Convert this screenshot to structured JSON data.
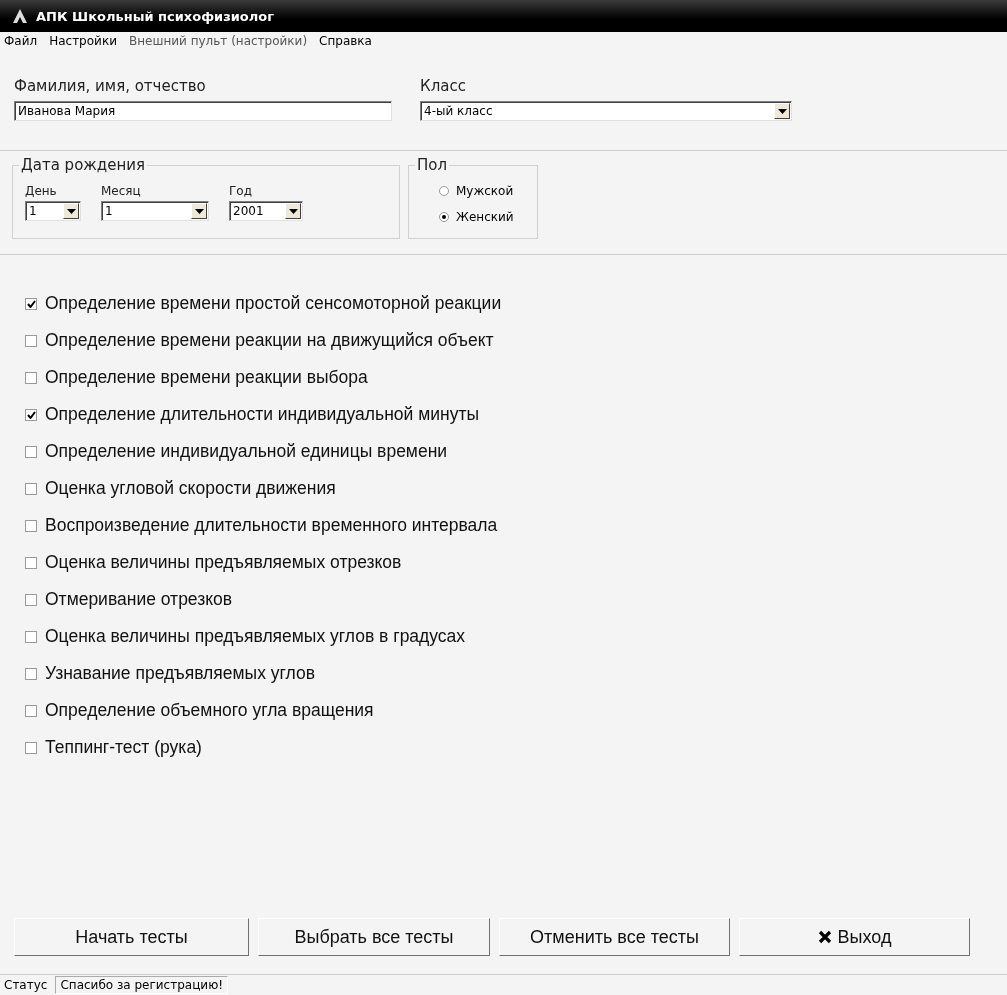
{
  "window": {
    "title": "АПК Школьный психофизиолог"
  },
  "menu": [
    {
      "label": "Файл",
      "disabled": false
    },
    {
      "label": "Настройки",
      "disabled": false
    },
    {
      "label": "Внешний пульт (настройки)",
      "disabled": true
    },
    {
      "label": "Справка",
      "disabled": false
    }
  ],
  "name": {
    "label": "Фамилия, имя, отчество",
    "value": "Иванова Мария"
  },
  "class": {
    "label": "Класс",
    "value": "4-ый класс"
  },
  "birth_date": {
    "title": "Дата рождения",
    "fields": [
      {
        "label": "День",
        "value": "1"
      },
      {
        "label": "Месяц",
        "value": "1"
      },
      {
        "label": "Год",
        "value": "2001"
      }
    ]
  },
  "gender": {
    "title": "Пол",
    "options": [
      {
        "label": "Мужской",
        "selected": false
      },
      {
        "label": "Женский",
        "selected": true
      }
    ]
  },
  "tests": [
    {
      "label": "Определение времени простой сенсомоторной реакции",
      "checked": true
    },
    {
      "label": "Определение времени реакции на движущийся объект",
      "checked": false
    },
    {
      "label": "Определение времени реакции выбора",
      "checked": false
    },
    {
      "label": "Определение длительности индивидуальной минуты",
      "checked": true
    },
    {
      "label": "Определение индивидуальной единицы времени",
      "checked": false
    },
    {
      "label": "Оценка угловой скорости движения",
      "checked": false
    },
    {
      "label": "Воспроизведение длительности временного интервала",
      "checked": false
    },
    {
      "label": "Оценка величины предъявляемых отрезков",
      "checked": false
    },
    {
      "label": "Отмеривание отрезков",
      "checked": false
    },
    {
      "label": "Оценка величины предъявляемых углов в градусах",
      "checked": false
    },
    {
      "label": "Узнавание предъявляемых углов",
      "checked": false
    },
    {
      "label": "Определение объемного угла вращения",
      "checked": false
    },
    {
      "label": "Теппинг-тест (рука)",
      "checked": false
    }
  ],
  "buttons": [
    {
      "label": "Начать тесты",
      "kind": "plain"
    },
    {
      "label": "Выбрать все тесты",
      "kind": "plain"
    },
    {
      "label": "Отменить все тесты",
      "kind": "plain"
    },
    {
      "label": "Выход",
      "kind": "close"
    }
  ],
  "status_bar": {
    "label": "Статус",
    "message": "Спасибо за регистрацию!"
  }
}
